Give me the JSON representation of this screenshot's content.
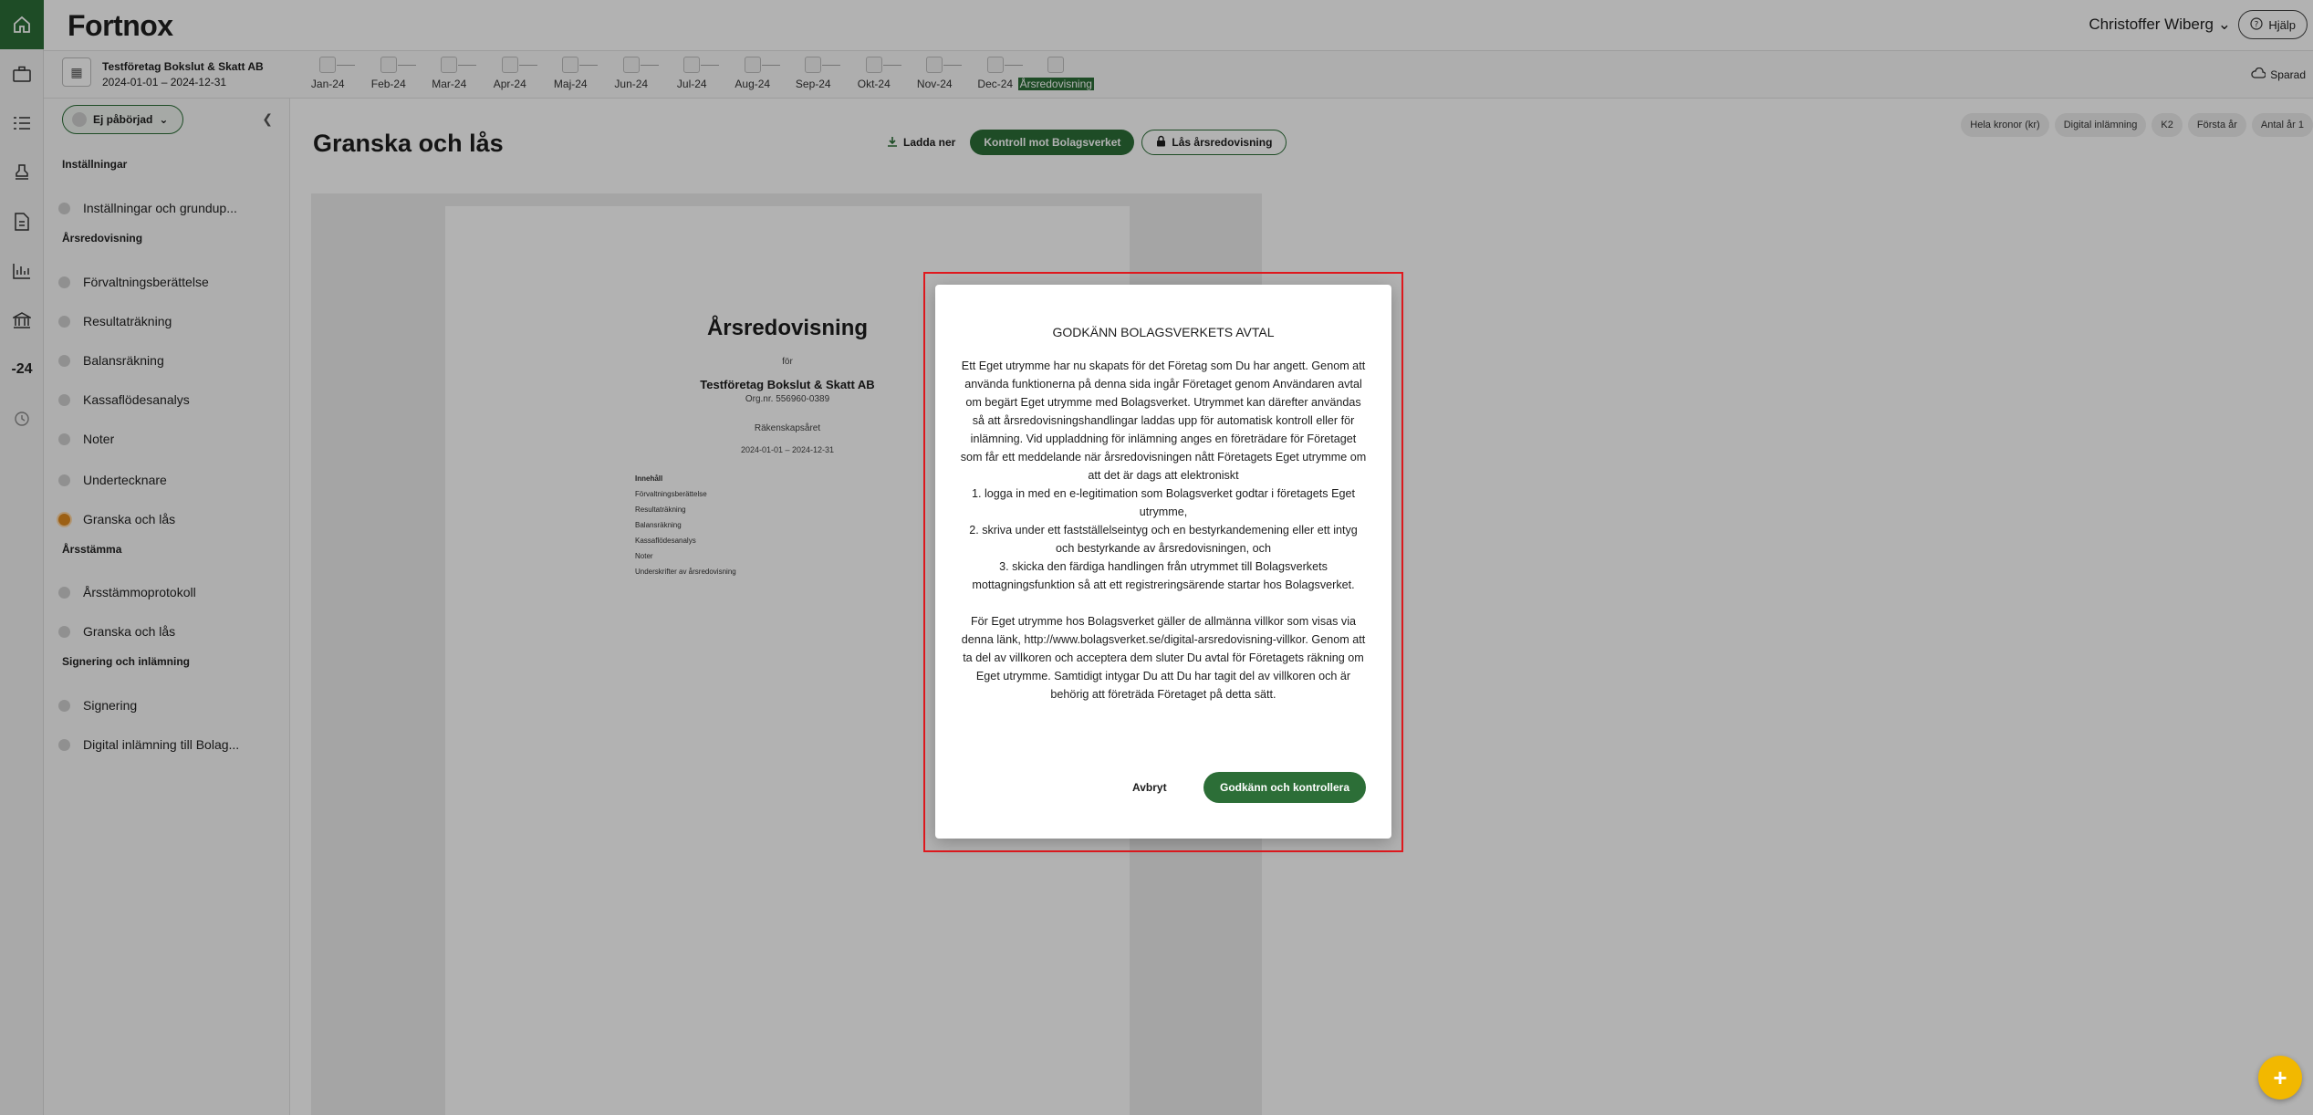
{
  "app": {
    "logo": "Fortnox",
    "user_name": "Christoffer Wiberg",
    "help_label": "Hjälp"
  },
  "rail": {
    "year_label": "-24"
  },
  "company": {
    "name": "Testföretag Bokslut & Skatt AB",
    "period": "2024-01-01 – 2024-12-31"
  },
  "months": [
    "Jan-24",
    "Feb-24",
    "Mar-24",
    "Apr-24",
    "Maj-24",
    "Jun-24",
    "Jul-24",
    "Aug-24",
    "Sep-24",
    "Okt-24",
    "Nov-24",
    "Dec-24"
  ],
  "annual_tab": "Årsredovisning",
  "saved_label": "Sparad",
  "sidebar": {
    "status": "Ej påbörjad",
    "sections": {
      "settings": "Inställningar",
      "annual": "Årsredovisning",
      "meeting": "Årsstämma",
      "signing": "Signering och inlämning"
    },
    "items": {
      "settings_basics": "Inställningar och grundup...",
      "management_report": "Förvaltningsberättelse",
      "income_statement": "Resultaträkning",
      "balance_sheet": "Balansräkning",
      "cash_flow": "Kassaflödesanalys",
      "notes": "Noter",
      "signatories": "Undertecknare",
      "review_lock": "Granska och lås",
      "meeting_minutes": "Årsstämmoprotokoll",
      "meeting_review_lock": "Granska och lås",
      "signing": "Signering",
      "digital_submission": "Digital inlämning till Bolag..."
    }
  },
  "main": {
    "title": "Granska och lås",
    "download": "Ladda ner",
    "check": "Kontroll mot Bolagsverket",
    "lock": "Lås årsredovisning",
    "tags": [
      "Hela kronor (kr)",
      "Digital inlämning",
      "K2",
      "Första år",
      "Antal år 1"
    ]
  },
  "document": {
    "title": "Årsredovisning",
    "for_label": "för",
    "company": "Testföretag Bokslut & Skatt AB",
    "org_nr": "Org.nr. 556960-0389",
    "fiscal_year_label": "Räkenskapsåret",
    "period": "2024-01-01 – 2024-12-31",
    "toc_heading": "Innehåll",
    "toc": [
      "Förvaltningsberättelse",
      "Resultaträkning",
      "Balansräkning",
      "Kassaflödesanalys",
      "Noter",
      "Underskrifter av årsredovisning"
    ]
  },
  "modal": {
    "title": "GODKÄNN BOLAGSVERKETS AVTAL",
    "paragraph1": "Ett Eget utrymme har nu skapats för det Företag som Du har angett. Genom att använda funktionerna på denna sida ingår Företaget genom Användaren avtal om begärt Eget utrymme med Bolagsverket. Utrymmet kan därefter användas så att årsredovisningshandlingar laddas upp för automatisk kontroll eller för inlämning. Vid uppladdning för inlämning anges en företrädare för Företaget som får ett meddelande när årsredovisningen nått Företagets Eget utrymme om att det är dags att elektroniskt",
    "step1": "1. logga in med en e-legitimation som Bolagsverket godtar i företagets Eget utrymme,",
    "step2": "2. skriva under ett fastställelseintyg och en bestyrkandemening eller ett intyg och bestyrkande av årsredovisningen, och",
    "step3": "3. skicka den färdiga handlingen från utrymmet till Bolagsverkets mottagningsfunktion så att ett registreringsärende startar hos Bolagsverket.",
    "paragraph2": "För Eget utrymme hos Bolagsverket gäller de allmänna villkor som visas via denna länk, http://www.bolagsverket.se/digital-arsredovisning-villkor. Genom att ta del av villkoren och acceptera dem sluter Du avtal för Företagets räkning om Eget utrymme. Samtidigt intygar Du att Du har tagit del av villkoren och är behörig att företräda Företaget på detta sätt.",
    "cancel": "Avbryt",
    "confirm": "Godkänn och kontrollera"
  },
  "colors": {
    "brand_green": "#2c6e37",
    "active_step": "#e08a1e",
    "fab": "#f2b800",
    "focus_frame": "#e0191e"
  }
}
